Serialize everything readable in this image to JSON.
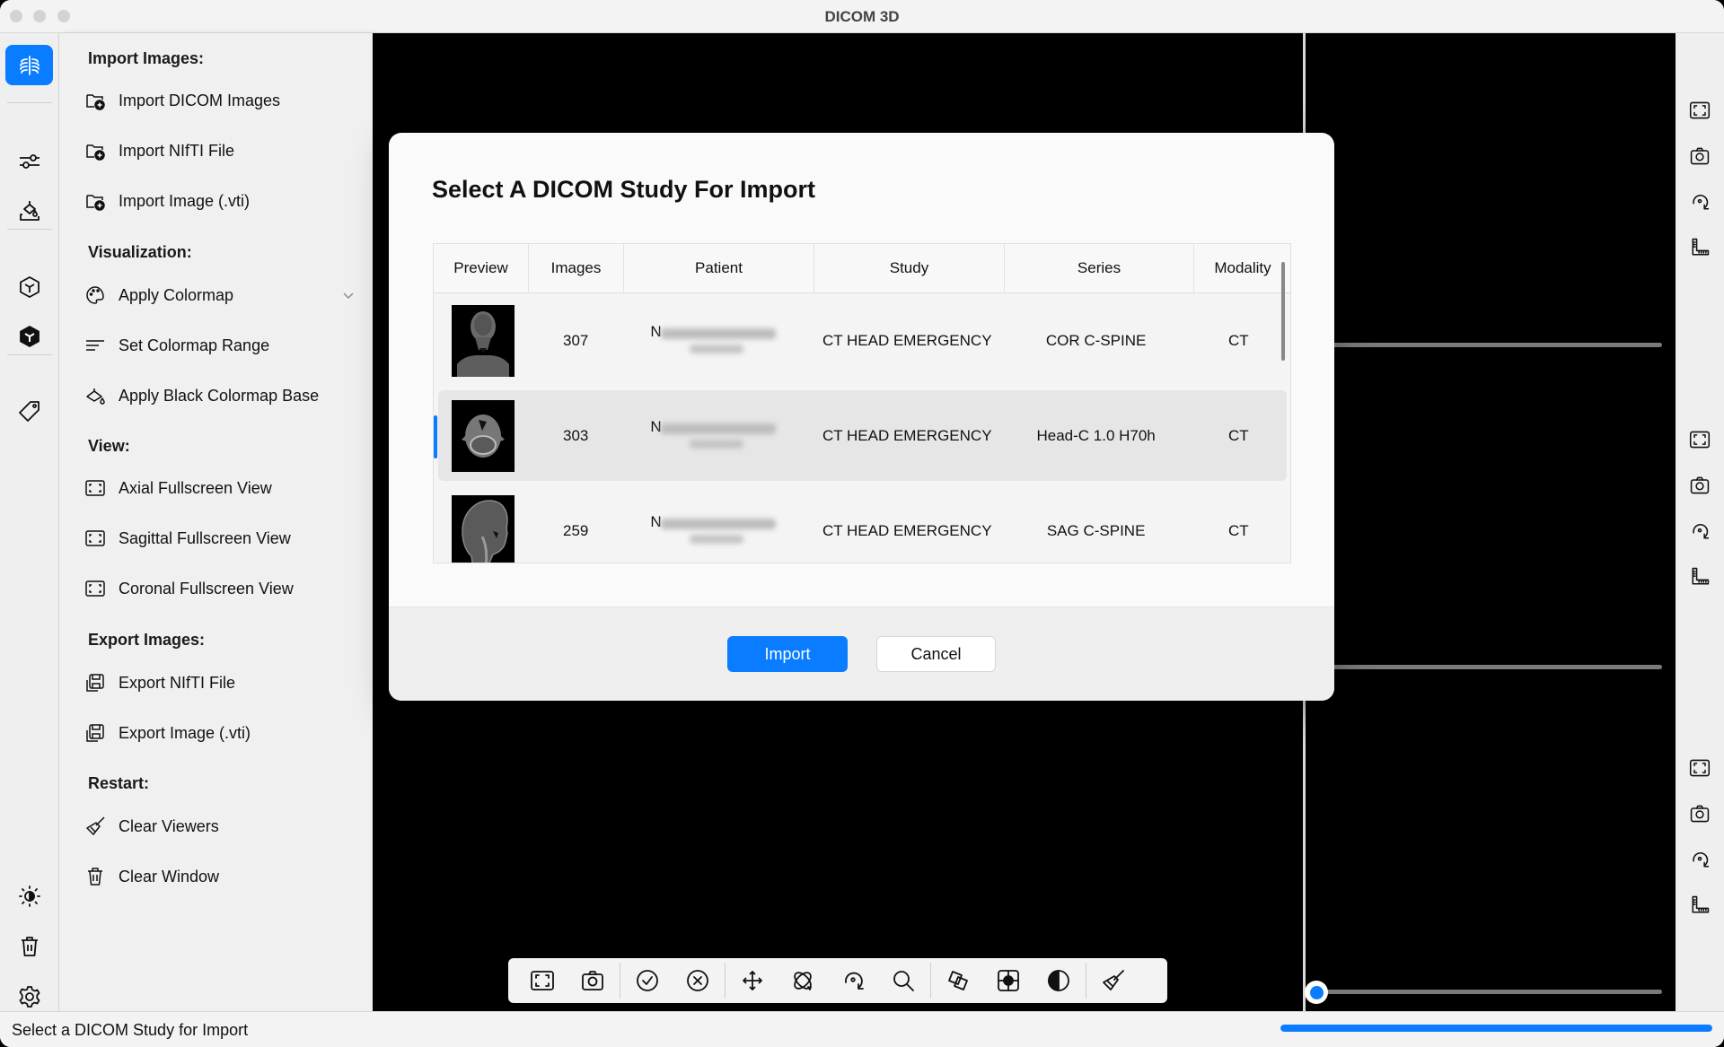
{
  "window": {
    "title": "DICOM 3D"
  },
  "rail": {
    "items": [
      {
        "icon": "ribcage-icon",
        "active": true
      },
      {
        "icon": "sliders-icon",
        "active": false
      },
      {
        "icon": "paint-bucket-icon",
        "active": false
      },
      {
        "icon": "cube-outline-icon",
        "active": false
      },
      {
        "icon": "cube-filled-icon",
        "active": false
      },
      {
        "icon": "tag-icon",
        "active": false
      }
    ],
    "bottom": [
      {
        "icon": "brightness-contrast-icon"
      },
      {
        "icon": "trash-icon"
      },
      {
        "icon": "gear-icon"
      }
    ]
  },
  "panel": {
    "sections": [
      {
        "title": "Import Images:",
        "items": [
          {
            "label": "Import DICOM Images",
            "icon": "folder-add-icon"
          },
          {
            "label": "Import NIfTI File",
            "icon": "folder-add-icon"
          },
          {
            "label": "Import Image (.vti)",
            "icon": "folder-add-icon"
          }
        ]
      },
      {
        "title": "Visualization:",
        "items": [
          {
            "label": "Apply Colormap",
            "icon": "palette-icon",
            "has_dropdown": true
          },
          {
            "label": "Set Colormap Range",
            "icon": "lines-icon"
          },
          {
            "label": "Apply Black Colormap Base",
            "icon": "paint-bucket-icon"
          }
        ]
      },
      {
        "title": "View:",
        "items": [
          {
            "label": "Axial Fullscreen View",
            "icon": "fullscreen-icon"
          },
          {
            "label": "Sagittal Fullscreen View",
            "icon": "fullscreen-icon"
          },
          {
            "label": "Coronal Fullscreen View",
            "icon": "fullscreen-icon"
          }
        ]
      },
      {
        "title": "Export Images:",
        "items": [
          {
            "label": "Export NIfTI File",
            "icon": "save-icon"
          },
          {
            "label": "Export Image (.vti)",
            "icon": "save-icon"
          }
        ]
      },
      {
        "title": "Restart:",
        "items": [
          {
            "label": "Clear Viewers",
            "icon": "broom-icon"
          },
          {
            "label": "Clear Window",
            "icon": "trash-icon"
          }
        ]
      }
    ]
  },
  "dialog": {
    "title": "Select A DICOM Study For Import",
    "columns": [
      "Preview",
      "Images",
      "Patient",
      "Study",
      "Series",
      "Modality"
    ],
    "rows": [
      {
        "images": "307",
        "patient": "N",
        "study": "CT  HEAD EMERGENCY",
        "series": "COR C-SPINE",
        "modality": "CT",
        "preview": "coronal",
        "selected": false
      },
      {
        "images": "303",
        "patient": "N",
        "study": "CT  HEAD EMERGENCY",
        "series": "Head-C  1.0  H70h",
        "modality": "CT",
        "preview": "axial",
        "selected": true
      },
      {
        "images": "259",
        "patient": "N",
        "study": "CT  HEAD EMERGENCY",
        "series": "SAG C-SPINE",
        "modality": "CT",
        "preview": "sagittal",
        "selected": false
      }
    ],
    "import_label": "Import",
    "cancel_label": "Cancel"
  },
  "viewer_toolbar": [
    "fullscreen-icon",
    "camera-icon",
    "|",
    "check-circle-icon",
    "x-circle-icon",
    "|",
    "pan-icon",
    "rotate-3d-icon",
    "rotate-icon",
    "zoom-icon",
    "|",
    "reslice-icon",
    "crosshair-icon",
    "contrast-icon",
    "|",
    "broom-icon"
  ],
  "right_rail": {
    "groups": [
      [
        "fullscreen-icon",
        "camera-icon",
        "rotate-icon",
        "ruler-icon"
      ],
      [
        "fullscreen-icon",
        "camera-icon",
        "rotate-icon",
        "ruler-icon"
      ],
      [
        "fullscreen-icon",
        "camera-icon",
        "rotate-icon",
        "ruler-icon"
      ]
    ]
  },
  "slice_slider": {
    "value": 0.0
  },
  "status": {
    "text": "Select a DICOM Study for Import",
    "progress": 1.0
  },
  "colors": {
    "accent": "#0a7cff"
  }
}
